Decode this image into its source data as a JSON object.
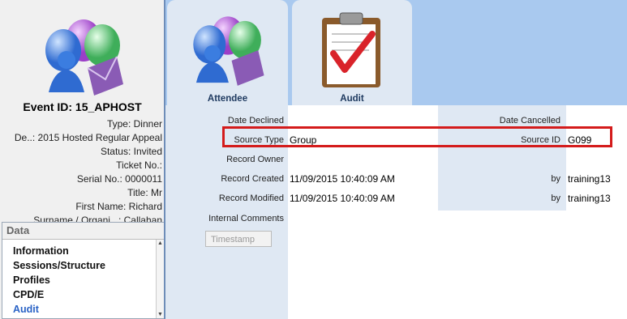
{
  "left_panel": {
    "icon": "attendee-balloons-icon",
    "event_id": "Event ID: 15_APHOST",
    "info_lines": [
      "Type: Dinner",
      "De..: 2015 Hosted Regular Appeal",
      "Status: Invited",
      "Ticket No.:",
      "Serial No.: 0000011",
      "Title: Mr",
      "First Name: Richard",
      "Surname / Organi...: Callahan"
    ],
    "data_section": {
      "header": "Data",
      "items": [
        "Information",
        "Sessions/Structure",
        "Profiles",
        "CPD/E",
        "Audit"
      ]
    }
  },
  "tabs": [
    {
      "label": "Attendee",
      "icon": "attendee-balloons-icon"
    },
    {
      "label": "Audit",
      "icon": "clipboard-check-icon"
    }
  ],
  "form": {
    "date_declined_label": "Date Declined",
    "date_declined_value": "",
    "date_cancelled_label": "Date Cancelled",
    "date_cancelled_value": "",
    "source_type_label": "Source Type",
    "source_type_value": "Group",
    "source_id_label": "Source ID",
    "source_id_value": "G099",
    "record_owner_label": "Record Owner",
    "record_owner_value": "",
    "record_created_label": "Record Created",
    "record_created_value": "11/09/2015 10:40:09 AM",
    "record_created_by_label": "by",
    "record_created_by_value": "training13",
    "record_modified_label": "Record Modified",
    "record_modified_value": "11/09/2015 10:40:09 AM",
    "record_modified_by_label": "by",
    "record_modified_by_value": "training13",
    "internal_comments_label": "Internal Comments",
    "internal_comments_value": "",
    "timestamp_button": "Timestamp"
  },
  "colors": {
    "tab_bar": "#a9c9ef",
    "highlight": "#d41b1b",
    "active_item": "#2a63c6"
  }
}
